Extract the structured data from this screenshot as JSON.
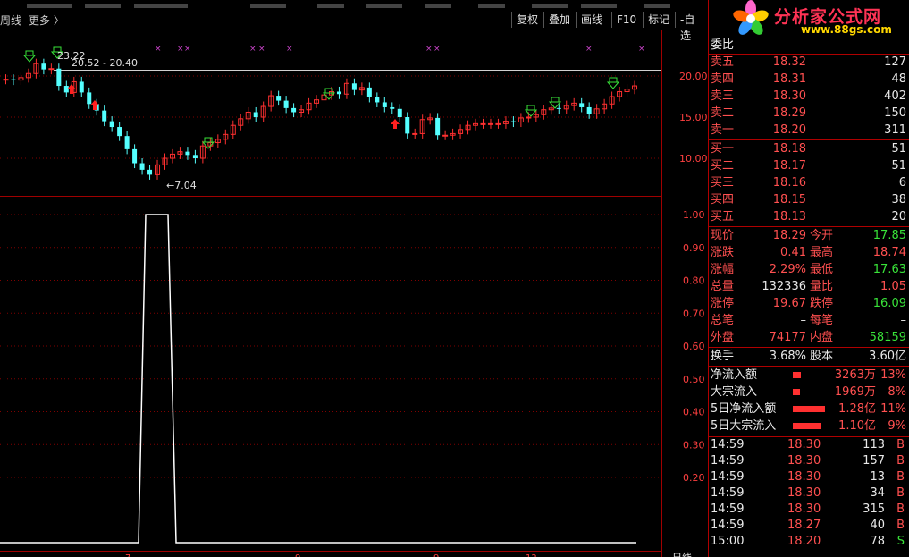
{
  "toolbar": {
    "period": "周线",
    "more": "更多",
    "more_arrow": "〉",
    "buttons": [
      "复权",
      "叠加",
      "画线",
      "F10",
      "标记",
      "-自选"
    ]
  },
  "logo": {
    "title": "分析家公式网",
    "url": "www.88gs.com"
  },
  "chart": {
    "price_axis": [
      "20.00",
      "15.00",
      "10.00"
    ],
    "high_label": "23.22",
    "range_label": "20.52 - 20.40",
    "low_label": "7.04",
    "indicator_axis": [
      "1.00",
      "0.90",
      "0.80",
      "0.70",
      "0.60",
      "0.50",
      "0.40",
      "0.30",
      "0.20"
    ],
    "bottom_label": "日线",
    "bottom_ticks": [
      "7",
      "9",
      "9",
      "12"
    ],
    "colors": {
      "up": "#ff3030",
      "down": "#54ffff",
      "grid": "#800000",
      "signal_up": "#39e239",
      "signal_down": "#ff2020",
      "marker": "#cc44cc"
    }
  },
  "quote": {
    "header": "委比",
    "sell": [
      {
        "label": "卖五",
        "price": "18.32",
        "vol": "127"
      },
      {
        "label": "卖四",
        "price": "18.31",
        "vol": "48"
      },
      {
        "label": "卖三",
        "price": "18.30",
        "vol": "402"
      },
      {
        "label": "卖二",
        "price": "18.29",
        "vol": "150"
      },
      {
        "label": "卖一",
        "price": "18.20",
        "vol": "311"
      }
    ],
    "buy": [
      {
        "label": "买一",
        "price": "18.18",
        "vol": "51"
      },
      {
        "label": "买二",
        "price": "18.17",
        "vol": "51"
      },
      {
        "label": "买三",
        "price": "18.16",
        "vol": "6"
      },
      {
        "label": "买四",
        "price": "18.15",
        "vol": "38"
      },
      {
        "label": "买五",
        "price": "18.13",
        "vol": "20"
      }
    ],
    "stats": [
      {
        "l1": "现价",
        "v1": "18.29",
        "c1": "red",
        "l2": "今开",
        "v2": "17.85",
        "c2": "grn"
      },
      {
        "l1": "涨跌",
        "v1": "0.41",
        "c1": "red",
        "l2": "最高",
        "v2": "18.74",
        "c2": "red"
      },
      {
        "l1": "涨幅",
        "v1": "2.29%",
        "c1": "red",
        "l2": "最低",
        "v2": "17.63",
        "c2": "grn"
      },
      {
        "l1": "总量",
        "v1": "132336",
        "c1": "wht",
        "l2": "量比",
        "v2": "1.05",
        "c2": "red"
      },
      {
        "l1": "涨停",
        "v1": "19.67",
        "c1": "red",
        "l2": "跌停",
        "v2": "16.09",
        "c2": "grn"
      },
      {
        "l1": "总笔",
        "v1": "–",
        "c1": "wht",
        "l2": "每笔",
        "v2": "–",
        "c2": "wht"
      },
      {
        "l1": "外盘",
        "v1": "74177",
        "c1": "red",
        "l2": "内盘",
        "v2": "58159",
        "c2": "grn"
      }
    ],
    "turnover": {
      "l1": "换手",
      "v1": "3.68%",
      "l2": "股本",
      "v2": "3.60亿"
    },
    "flows": [
      {
        "label": "净流入额",
        "value": "3263万",
        "pct": "13%",
        "bar": 0.1
      },
      {
        "label": "大宗流入",
        "value": "1969万",
        "pct": "8%",
        "bar": 0.05
      },
      {
        "label": "5日净流入额",
        "value": "1.28亿",
        "pct": "11%",
        "bar": 1.0
      },
      {
        "label": "5日大宗流入",
        "value": "1.10亿",
        "pct": "9%",
        "bar": 0.85
      }
    ],
    "ticks": [
      {
        "time": "14:59",
        "price": "18.30",
        "vol": "113",
        "side": "B"
      },
      {
        "time": "14:59",
        "price": "18.30",
        "vol": "157",
        "side": "B"
      },
      {
        "time": "14:59",
        "price": "18.30",
        "vol": "13",
        "side": "B"
      },
      {
        "time": "14:59",
        "price": "18.30",
        "vol": "34",
        "side": "B"
      },
      {
        "time": "14:59",
        "price": "18.30",
        "vol": "315",
        "side": "B"
      },
      {
        "time": "14:59",
        "price": "18.27",
        "vol": "40",
        "side": "B"
      },
      {
        "time": "15:00",
        "price": "18.20",
        "vol": "78",
        "side": "S"
      }
    ]
  }
}
